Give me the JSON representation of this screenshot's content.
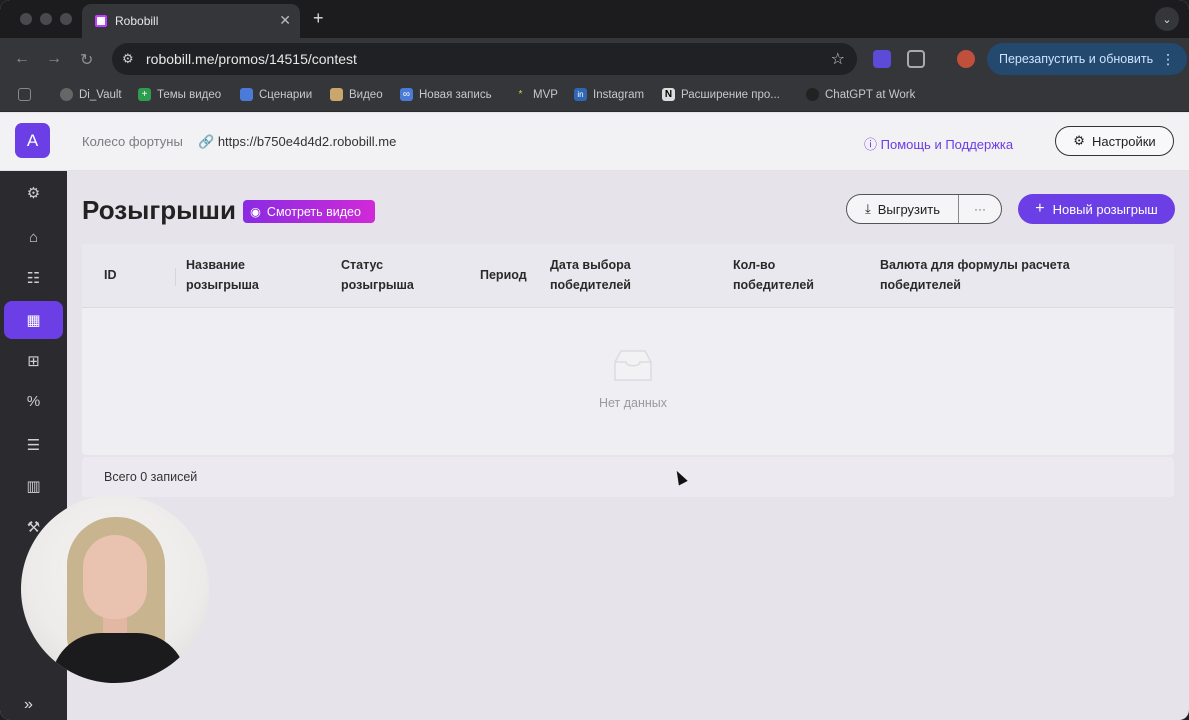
{
  "browser": {
    "tab_title": "Robobill",
    "url": "robobill.me/promos/14515/contest",
    "restart_label": "Перезапустить и обновить",
    "bookmarks": [
      "Di_Vault",
      "Темы видео",
      "Сценарии",
      "Видео",
      "Новая запись",
      "MVP",
      "Instagram",
      "Расширение про...",
      "ChatGPT at Work"
    ]
  },
  "header": {
    "avatar_letter": "A",
    "breadcrumb": "Колесо фортуны",
    "link": "https://b750e4d4d2.robobill.me",
    "help": "Помощь и Поддержка",
    "settings": "Настройки"
  },
  "page": {
    "title": "Розыгрыши",
    "video_button": "Смотреть видео",
    "export_button": "Выгрузить",
    "more_button": "···",
    "new_button": "Новый розыгрыш"
  },
  "table": {
    "columns": [
      "ID",
      "Название розыгрыша",
      "Статус розыгрыша",
      "Период",
      "Дата выбора победителей",
      "Кол-во победителей",
      "Валюта для формулы расчета победителей"
    ],
    "empty_text": "Нет данных",
    "footer": "Всего 0 записей"
  },
  "sidebar": {
    "icons": [
      "gear-icon",
      "home-icon",
      "sliders-icon",
      "calendar-icon",
      "gift-icon",
      "percent-icon",
      "list-icon",
      "chart-icon",
      "wrench-icon"
    ],
    "active_index": 3
  },
  "colors": {
    "accent": "#6b3ee6",
    "sidebar": "#2b2b2f"
  }
}
